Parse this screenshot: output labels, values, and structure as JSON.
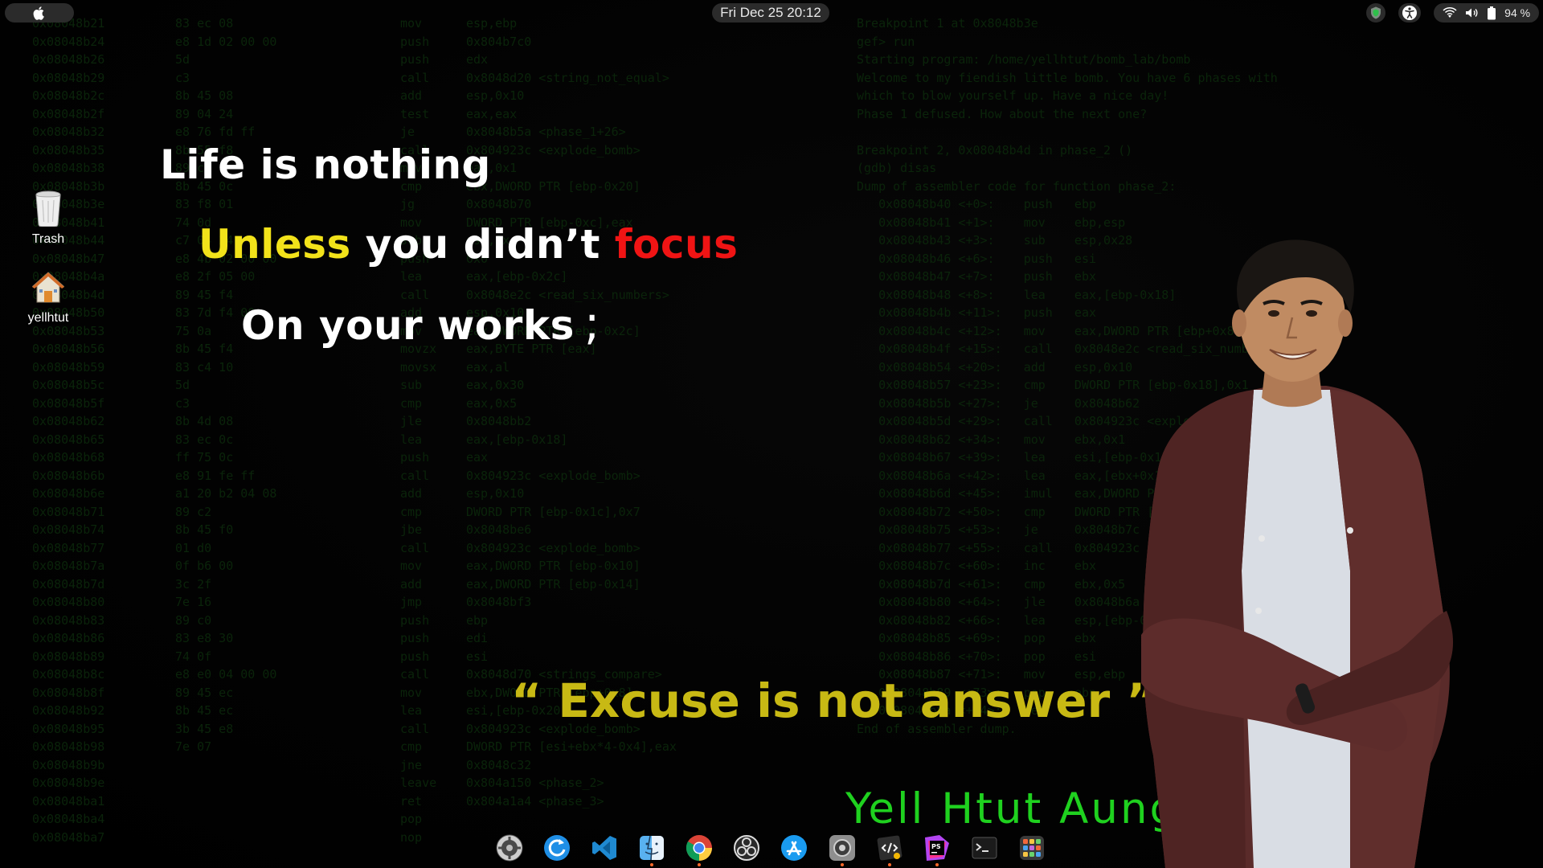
{
  "topbar": {
    "apple_menu_icon": "apple-logo-icon",
    "clock": "Fri Dec 25  20:12",
    "battery_percent": "94 %",
    "status_icons": [
      "shield-icon",
      "accessibility-icon",
      "wifi-icon",
      "volume-icon",
      "battery-icon"
    ]
  },
  "desktop_icons": [
    {
      "label": "Trash",
      "icon": "trash-icon"
    },
    {
      "label": "yellhtut",
      "icon": "home-folder-icon"
    }
  ],
  "wallpaper": {
    "line1": "Life is  nothing",
    "line2_a": "Unless",
    "line2_b": " you didn’t ",
    "line2_c": "focus",
    "line3": "On your works",
    "line3_semicolon": ";",
    "excuse": "“ Excuse is not answer ”",
    "signature": "Yell Htut Aung",
    "colors": {
      "white": "#ffffff",
      "yellow": "#f2e21a",
      "red": "#f01414",
      "excuse": "#c8b914",
      "signature": "#1fd11f"
    }
  },
  "dock": {
    "items": [
      {
        "name": "system-settings-icon",
        "running": false
      },
      {
        "name": "software-updater-icon",
        "running": false
      },
      {
        "name": "vscode-icon",
        "running": false
      },
      {
        "name": "finder-icon",
        "running": true
      },
      {
        "name": "chrome-icon",
        "running": true
      },
      {
        "name": "obs-studio-icon",
        "running": false
      },
      {
        "name": "app-store-icon",
        "running": false
      },
      {
        "name": "settings-gear-icon",
        "running": true
      },
      {
        "name": "code-editor-icon",
        "running": true
      },
      {
        "name": "phpstorm-icon",
        "running": true
      },
      {
        "name": "terminal-icon",
        "running": false
      },
      {
        "name": "app-launcher-icon",
        "running": false
      }
    ]
  }
}
